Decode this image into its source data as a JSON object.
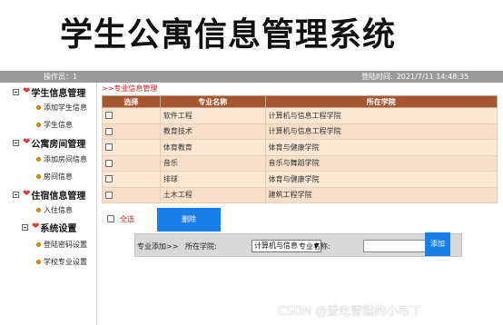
{
  "app": {
    "title": "学生公寓信息管理系统"
  },
  "status": {
    "operator": "操作员：1",
    "login_time_label": "登陆时间:",
    "login_time": "2021/7/11 14:48:35"
  },
  "sidebar": {
    "groups": [
      {
        "label": "学生信息管理",
        "items": [
          "添加学生信息",
          "学生信息"
        ]
      },
      {
        "label": "公寓房间管理",
        "items": [
          "添加房间信息",
          "房间信息"
        ]
      },
      {
        "label": "住宿信息管理",
        "items": [
          "入住信息"
        ]
      },
      {
        "label": "系统设置",
        "items": [
          "登陆密码设置",
          "学校专业设置"
        ]
      }
    ]
  },
  "main": {
    "breadcrumb": ">>专业信息管理",
    "table": {
      "headers": [
        "选择",
        "专业名称",
        "所在学院"
      ],
      "rows": [
        {
          "major": "软件工程",
          "college": "计算机与信息工程学院"
        },
        {
          "major": "教育技术",
          "college": "计算机与信息工程学院"
        },
        {
          "major": "体育教育",
          "college": "体育与健康学院"
        },
        {
          "major": "音乐",
          "college": "音乐与舞蹈学院"
        },
        {
          "major": "排球",
          "college": "体育与健康学院"
        },
        {
          "major": "土木工程",
          "college": "建筑工程学院"
        }
      ]
    },
    "select_all_label": "全选",
    "delete_label": "删除",
    "add_form": {
      "title": "专业添加>>",
      "college_label": "所在学院:",
      "college_value": "计算机与信息",
      "major_label": "专业名称:",
      "major_value": "",
      "add_label": "添加"
    }
  },
  "watermark": "CSDN @爱吃雪糕的小布丁"
}
